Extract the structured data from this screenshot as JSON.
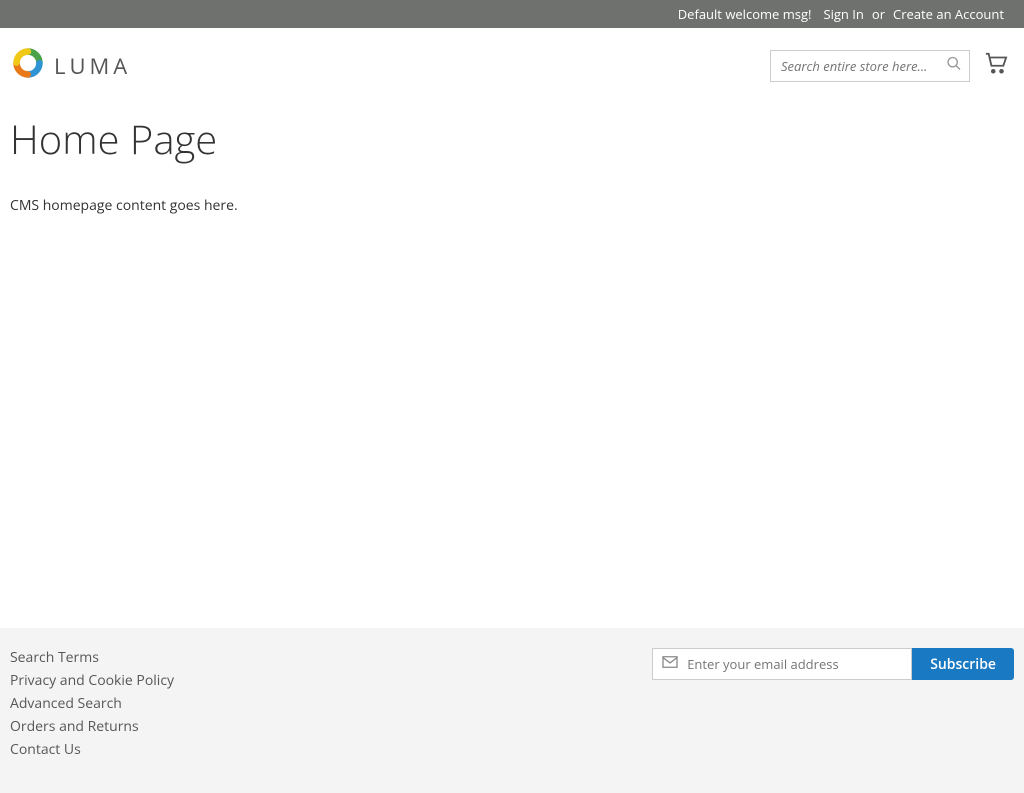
{
  "panel": {
    "welcome": "Default welcome msg!",
    "signin": "Sign In",
    "or": "or",
    "create": "Create an Account"
  },
  "header": {
    "logo_text": "LUMA",
    "search_placeholder": "Search entire store here..."
  },
  "main": {
    "title": "Home Page",
    "content": "CMS homepage content goes here."
  },
  "footer": {
    "links": [
      "Search Terms",
      "Privacy and Cookie Policy",
      "Advanced Search",
      "Orders and Returns",
      "Contact Us"
    ],
    "newsletter_placeholder": "Enter your email address",
    "subscribe": "Subscribe"
  }
}
